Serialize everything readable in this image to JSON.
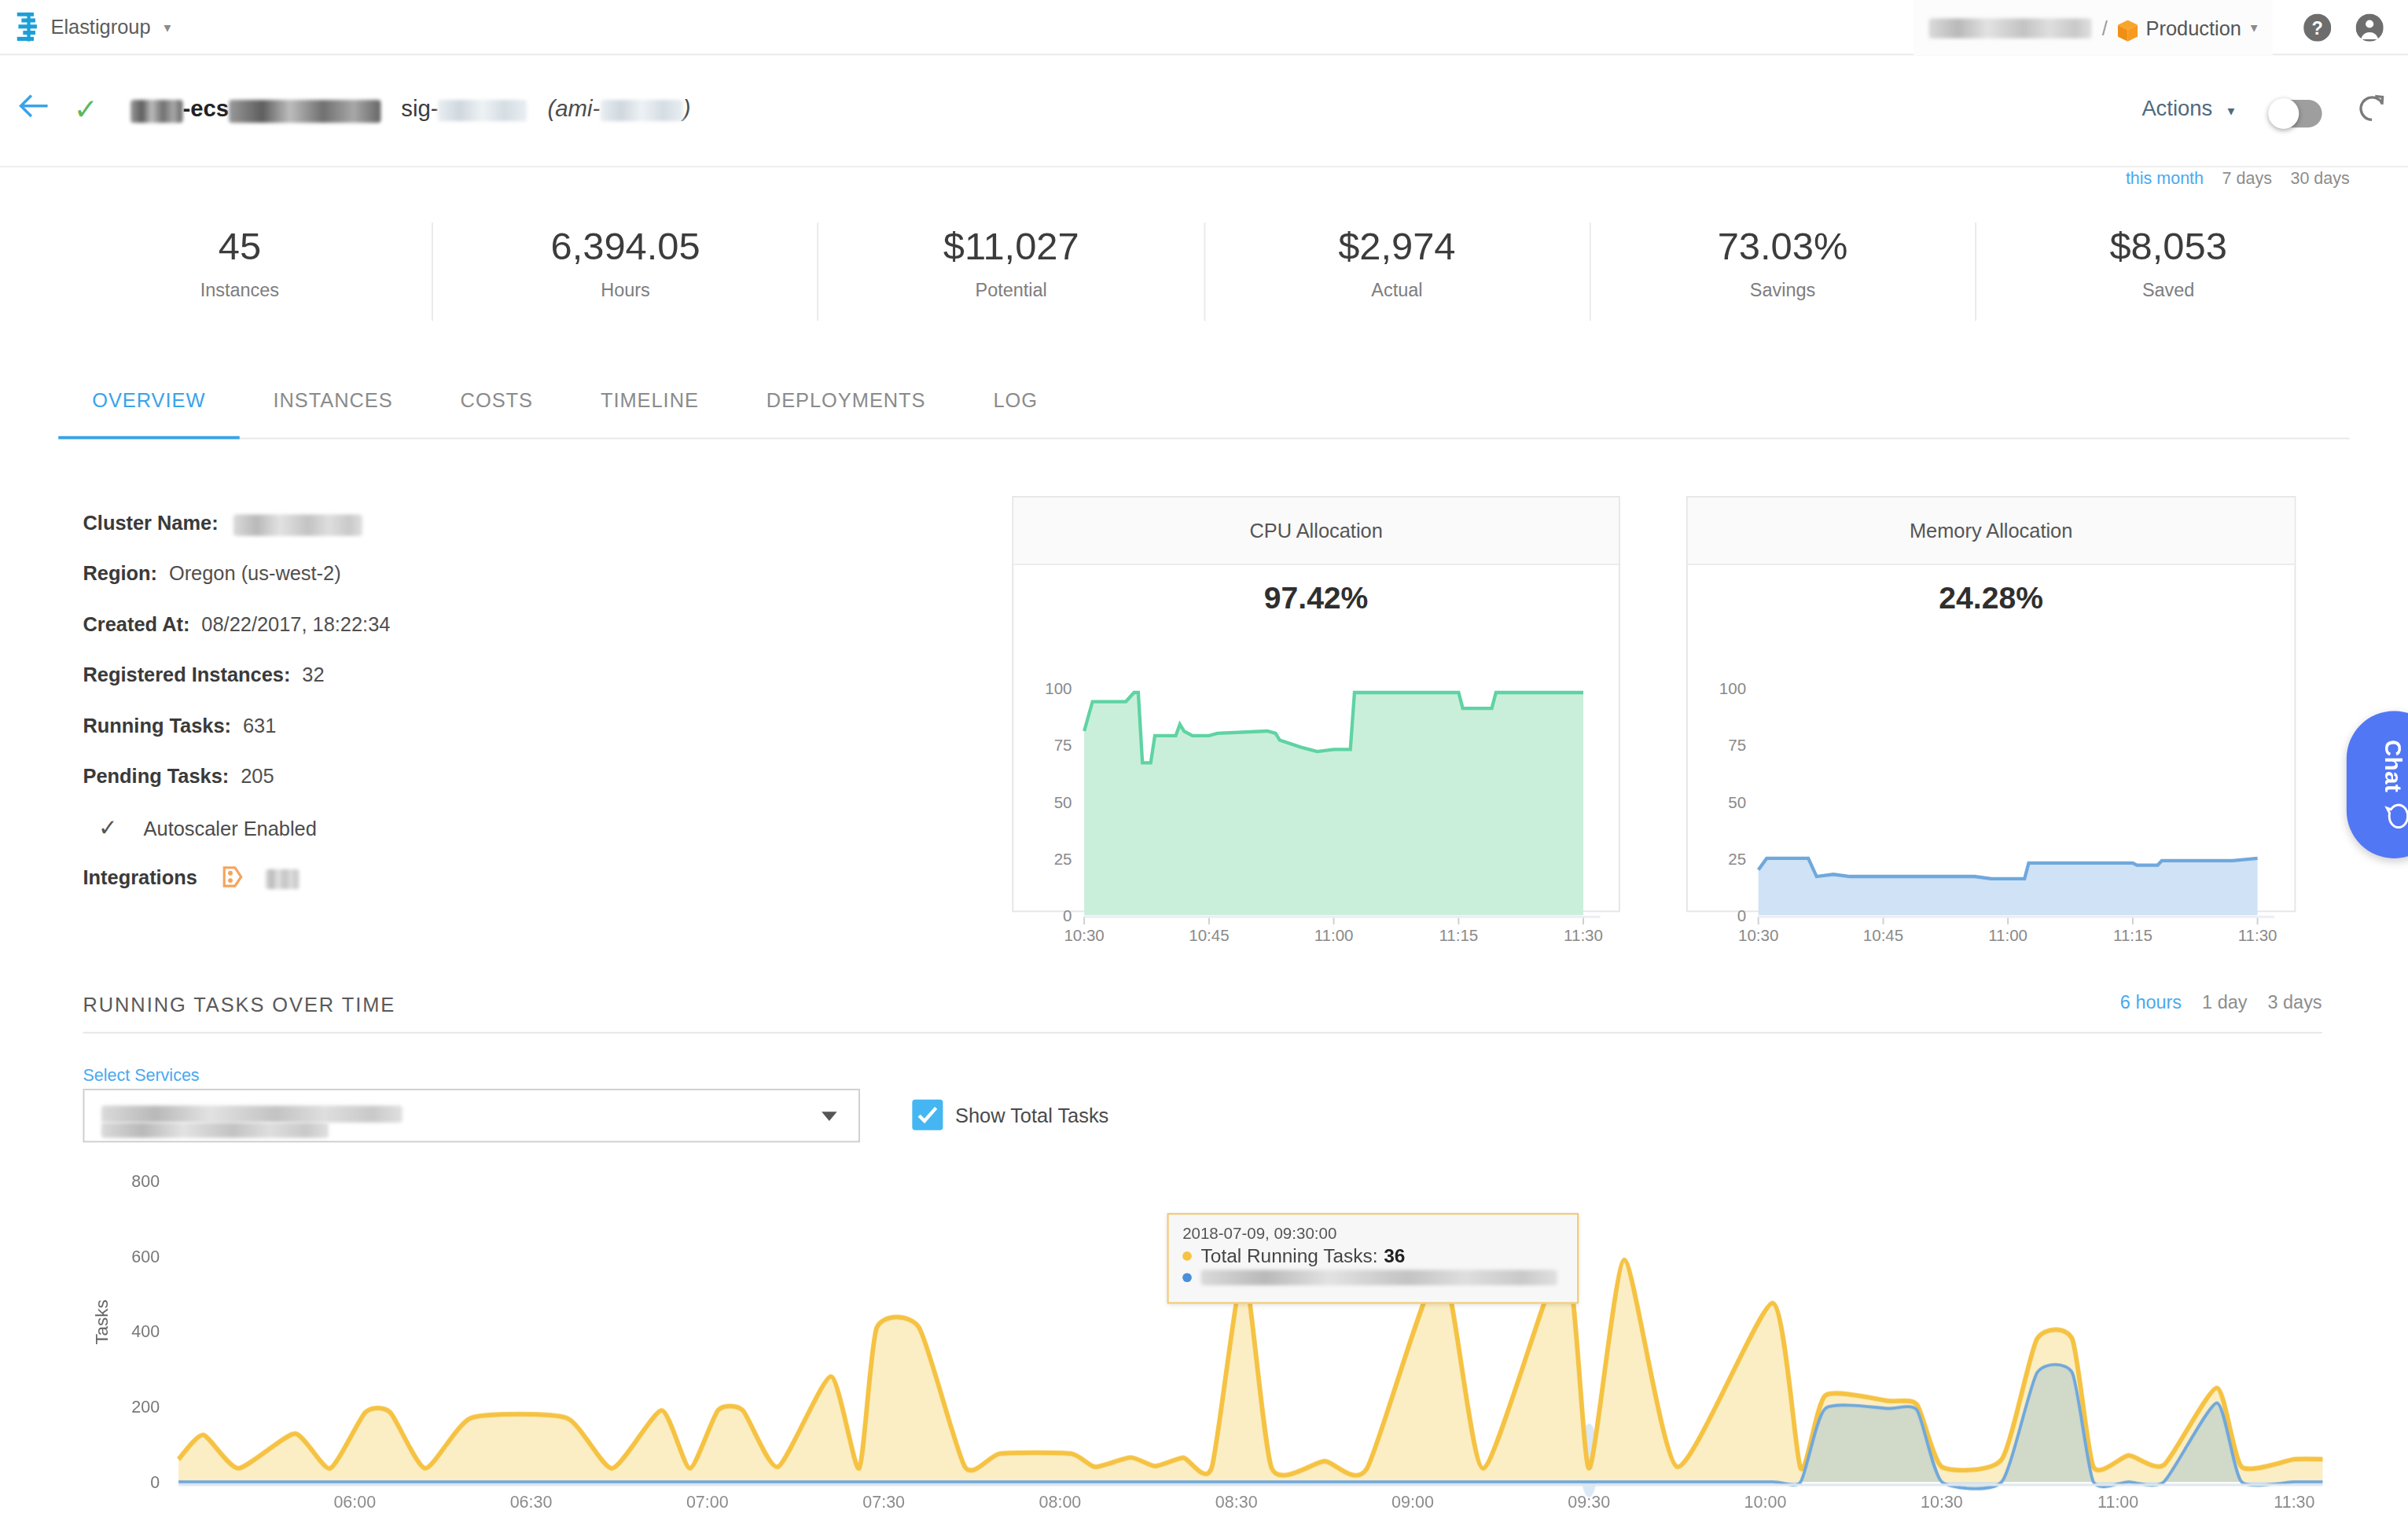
{
  "colors": {
    "accent": "#49a9f0",
    "yellow": "#f5c242",
    "service_blue": "#6fa8dc",
    "green": "#5fd3a3",
    "chat": "#5277f5",
    "ok_green": "#5cb85c",
    "env_orange": "#f79a1e"
  },
  "topbar": {
    "brand": "Elastigroup",
    "caret": "▾",
    "path_separator": "/",
    "environment": "Production",
    "help_icon": "help-circle-icon",
    "account_icon": "user-circle-icon"
  },
  "header": {
    "back_icon": "arrow-left-icon",
    "status_icon": "check-icon",
    "name_suffix": "-ecs",
    "sig_label": "sig-",
    "ami_open": "(ami-",
    "ami_close": ")",
    "actions_label": "Actions",
    "actions_caret": "▾",
    "toggle_state": "off",
    "refresh_icon": "refresh-icon"
  },
  "period_filters": [
    {
      "label": "this month",
      "active": true
    },
    {
      "label": "7 days",
      "active": false
    },
    {
      "label": "30 days",
      "active": false
    }
  ],
  "stats": [
    {
      "value": "45",
      "label": "Instances"
    },
    {
      "value": "6,394.05",
      "label": "Hours"
    },
    {
      "value": "$11,027",
      "label": "Potential"
    },
    {
      "value": "$2,974",
      "label": "Actual"
    },
    {
      "value": "73.03%",
      "label": "Savings"
    },
    {
      "value": "$8,053",
      "label": "Saved"
    }
  ],
  "tabs": [
    {
      "label": "OVERVIEW",
      "active": true
    },
    {
      "label": "INSTANCES",
      "active": false
    },
    {
      "label": "COSTS",
      "active": false
    },
    {
      "label": "TIMELINE",
      "active": false
    },
    {
      "label": "DEPLOYMENTS",
      "active": false
    },
    {
      "label": "LOG",
      "active": false
    }
  ],
  "details": [
    {
      "label": "Cluster Name:",
      "value": ""
    },
    {
      "label": "Region:",
      "value": "Oregon (us-west-2)"
    },
    {
      "label": "Created At:",
      "value": "08/22/2017, 18:22:34"
    },
    {
      "label": "Registered Instances:",
      "value": "32"
    },
    {
      "label": "Running Tasks:",
      "value": "631"
    },
    {
      "label": "Pending Tasks:",
      "value": "205"
    }
  ],
  "autoscaler": {
    "check_icon": "check-icon",
    "label": "Autoscaler Enabled"
  },
  "integrations": {
    "label": "Integrations"
  },
  "running_tasks": {
    "section_title": "RUNNING TASKS OVER TIME",
    "ranges": [
      {
        "label": "6 hours",
        "active": true
      },
      {
        "label": "1 day",
        "active": false
      },
      {
        "label": "3 days",
        "active": false
      }
    ],
    "select_label": "Select Services",
    "checkbox_label": "Show Total Tasks",
    "checkbox_checked": true
  },
  "tooltip": {
    "timestamp": "2018-07-09, 09:30:00",
    "series1_label": "Total Running Tasks:",
    "series1_value": "36"
  },
  "chat": {
    "label": "Chat",
    "icon": "chat-bubble-icon"
  },
  "chart_data": [
    {
      "id": "cpu",
      "type": "area",
      "title": "CPU Allocation",
      "current_value": "97.42%",
      "ylim": [
        0,
        100
      ],
      "yticks": [
        0,
        25,
        50,
        75,
        100
      ],
      "xticks": [
        "10:30",
        "10:45",
        "11:00",
        "11:15",
        "11:30"
      ],
      "xlim_minutes": [
        0,
        60
      ],
      "color": "#5fd3a3",
      "fill": "#c9efda",
      "x": [
        0,
        1,
        5,
        6,
        6.5,
        7,
        8,
        8.5,
        11,
        11.5,
        12,
        13,
        15,
        16,
        22,
        23,
        23.5,
        26,
        28,
        30,
        32,
        32.5,
        45,
        45.5,
        49,
        49.5,
        60
      ],
      "values": [
        81,
        94,
        94,
        98,
        98,
        67,
        67,
        79,
        79,
        84,
        81,
        79,
        79,
        80,
        81,
        80,
        77,
        74,
        72,
        73,
        73,
        98,
        98,
        91,
        91,
        98,
        98
      ]
    },
    {
      "id": "memory",
      "type": "area",
      "title": "Memory Allocation",
      "current_value": "24.28%",
      "ylim": [
        0,
        100
      ],
      "yticks": [
        0,
        25,
        50,
        75,
        100
      ],
      "xticks": [
        "10:30",
        "10:45",
        "11:00",
        "11:15",
        "11:30"
      ],
      "xlim_minutes": [
        0,
        60
      ],
      "color": "#6fa8dc",
      "fill": "#cfe2f6",
      "x": [
        0,
        1,
        6,
        7,
        9,
        11,
        20,
        26,
        28,
        30,
        32,
        32.5,
        45,
        45.5,
        48,
        48.5,
        57,
        60
      ],
      "values": [
        20,
        25,
        25,
        17,
        18,
        17,
        17,
        17,
        16,
        16,
        16,
        23,
        23,
        22,
        22,
        24,
        24,
        25
      ]
    },
    {
      "id": "running_tasks",
      "type": "area",
      "title": "RUNNING TASKS OVER TIME",
      "ylabel": "Tasks",
      "ylim": [
        0,
        800
      ],
      "yticks": [
        0,
        200,
        400,
        600,
        800
      ],
      "xticks": [
        "06:00",
        "06:30",
        "07:00",
        "07:30",
        "08:00",
        "08:30",
        "09:00",
        "09:30",
        "10:00",
        "10:30",
        "11:00",
        "11:30"
      ],
      "xtick_hours": [
        6,
        6.5,
        7,
        7.5,
        8,
        8.5,
        9,
        9.5,
        10,
        10.5,
        11,
        11.5
      ],
      "xlim_hours": [
        5.5,
        11.58
      ],
      "highlight_hour": 9.5,
      "x": [
        5.5,
        5.57,
        5.67,
        5.83,
        5.93,
        6.03,
        6.1,
        6.2,
        6.33,
        6.6,
        6.73,
        6.87,
        6.95,
        7.03,
        7.1,
        7.2,
        7.35,
        7.43,
        7.48,
        7.6,
        7.73,
        7.83,
        8.03,
        8.1,
        8.2,
        8.27,
        8.35,
        8.43,
        8.52,
        8.6,
        8.75,
        8.87,
        9.08,
        9.2,
        9.43,
        9.5,
        9.6,
        9.75,
        10.02,
        10.1,
        10.17,
        10.35,
        10.43,
        10.5,
        10.67,
        10.77,
        10.87,
        10.93,
        11.03,
        11.13,
        11.28,
        11.35,
        11.5,
        11.58
      ],
      "series": [
        {
          "name": "Total Running Tasks",
          "color": "#f5c242",
          "fill": "#fbeec4",
          "values": [
            60,
            125,
            36,
            128,
            36,
            185,
            185,
            36,
            170,
            170,
            36,
            190,
            36,
            190,
            190,
            40,
            280,
            36,
            410,
            410,
            40,
            75,
            75,
            40,
            65,
            42,
            64,
            38,
            560,
            36,
            55,
            36,
            570,
            36,
            600,
            36,
            590,
            40,
            475,
            36,
            230,
            215,
            205,
            40,
            60,
            380,
            380,
            40,
            70,
            45,
            250,
            40,
            60,
            60
          ]
        },
        {
          "name": "Selected service",
          "color": "#6fa8dc",
          "fill": "#9dbfd1",
          "values": [
            0,
            0,
            0,
            0,
            0,
            0,
            0,
            0,
            0,
            0,
            0,
            0,
            0,
            0,
            0,
            0,
            0,
            0,
            0,
            0,
            0,
            0,
            0,
            0,
            0,
            0,
            0,
            0,
            0,
            0,
            0,
            0,
            0,
            0,
            0,
            0,
            0,
            0,
            0,
            0,
            195,
            195,
            190,
            0,
            0,
            290,
            290,
            0,
            0,
            0,
            210,
            0,
            0,
            0
          ]
        }
      ]
    }
  ]
}
